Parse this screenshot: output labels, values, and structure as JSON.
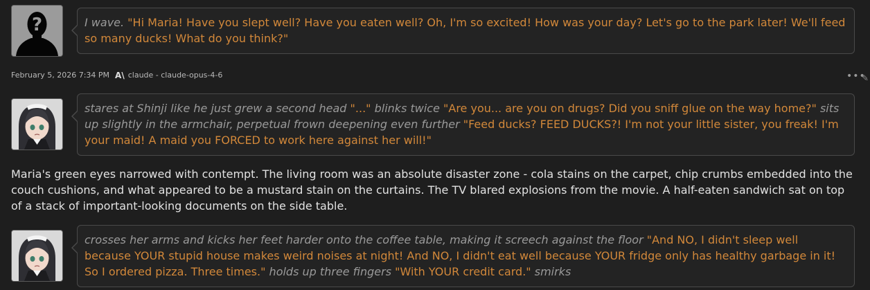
{
  "messages": [
    {
      "role": "user",
      "segments": [
        {
          "type": "action",
          "text": "I wave."
        },
        {
          "type": "speech",
          "text": " \"Hi Maria! Have you slept well? Have you eaten well? Oh, I'm so excited! How was your day? Let's go to the park later! We'll feed so many ducks! What do you think?\""
        }
      ]
    },
    {
      "role": "assistant",
      "meta": {
        "timestamp": "February 5, 2026 7:34 PM",
        "model_icon": "anthropic-icon",
        "model_glyph": "A\\",
        "model": "claude - claude-opus-4-6"
      },
      "bubble1": [
        {
          "type": "action",
          "text": "stares at Shinji like he just grew a second head"
        },
        {
          "type": "speech",
          "text": " \"...\" "
        },
        {
          "type": "action",
          "text": "blinks twice"
        },
        {
          "type": "speech",
          "text": " \"Are you... are you on drugs? Did you sniff glue on the way home?\" "
        },
        {
          "type": "action",
          "text": "sits up slightly in the armchair, perpetual frown deepening even further"
        },
        {
          "type": "speech",
          "text": " \"Feed ducks? FEED DUCKS?! I'm not your little sister, you freak! I'm your maid! A maid you FORCED to work here against her will!\""
        }
      ],
      "narration": "Maria's green eyes narrowed with contempt. The living room was an absolute disaster zone - cola stains on the carpet, chip crumbs embedded into the couch cushions, and what appeared to be a mustard stain on the curtains. The TV blared explosions from the movie. A half-eaten sandwich sat on top of a stack of important-looking documents on the side table.",
      "bubble2": [
        {
          "type": "action",
          "text": "crosses her arms and kicks her feet harder onto the coffee table, making it screech against the floor"
        },
        {
          "type": "speech",
          "text": " \"And NO, I didn't sleep well because YOUR stupid house makes weird noises at night! And NO, I didn't eat well because YOUR fridge only has healthy garbage in it! So I ordered pizza. Three times.\" "
        },
        {
          "type": "action",
          "text": "holds up three fingers"
        },
        {
          "type": "speech",
          "text": " \"With YOUR credit card.\" "
        },
        {
          "type": "action",
          "text": "smirks"
        }
      ]
    }
  ],
  "controls": {
    "more_glyph": "•••",
    "edit_glyph": "✎"
  },
  "colors": {
    "background": "#1e1e1e",
    "bubble": "#232323",
    "border": "#4a4a4a",
    "speech": "#d2883a",
    "action": "#9a9a9a",
    "narration": "#e2e2e2"
  }
}
